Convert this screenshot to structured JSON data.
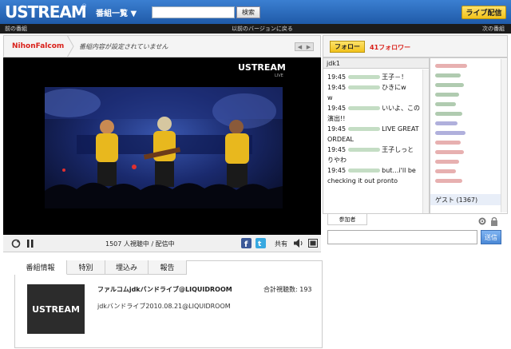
{
  "header": {
    "logo": "USTREAM",
    "logo_mark": "®",
    "menu_label": "番組一覧 ▼",
    "search_placeholder": "",
    "search_button": "検索",
    "live_button": "ライブ配信"
  },
  "subbar": {
    "prev": "前の番組",
    "old_version": "以前のバージョンに戻る",
    "next": "次の番組"
  },
  "channel": {
    "name": "NihonFalcom",
    "description": "番組内容が設定されていません",
    "nav": [
      "◀",
      "▶"
    ]
  },
  "follow": {
    "button": "フォロー",
    "count": "41フォロワー"
  },
  "video": {
    "watermark": "USTREAM",
    "watermark_sub": "LIVE"
  },
  "player": {
    "viewers": "1507 人視聴中 / 配信中",
    "share": "共有",
    "icons": [
      "refresh-icon",
      "pause-icon",
      "facebook-icon",
      "twitter-icon",
      "volume-icon",
      "fullscreen-icon"
    ]
  },
  "chat": {
    "room": "jdk1",
    "messages": [
      {
        "time": "19:45",
        "text": "王子－！"
      },
      {
        "time": "19:45",
        "text": "ひきにw"
      },
      {
        "time": "",
        "text": "w"
      },
      {
        "time": "19:45",
        "text": "いいよ、この"
      },
      {
        "time": "",
        "text": "演出!!"
      },
      {
        "time": "19:45",
        "text": "LIVE GREAT"
      },
      {
        "time": "",
        "text": "ORDEAL"
      },
      {
        "time": "19:45",
        "text": "王子しっと"
      },
      {
        "time": "",
        "text": "りやわ"
      },
      {
        "time": "19:45",
        "text": "but…i'll be"
      },
      {
        "time": "",
        "text": "checking it out pronto"
      }
    ],
    "guest_label": "ゲスト (1367)",
    "participants_tab": "参加者",
    "send_button": "送信"
  },
  "info": {
    "tabs": [
      "番組情報",
      "特別",
      "埋込み",
      "報告"
    ],
    "thumb_logo": "USTREAM",
    "program_title": "ファルコムjdkバンドライブ@LIQUIDROOM",
    "total_views": "合計視聴数: 193",
    "program_sub": "jdkバンドライブ2010.08.21@LIQUIDROOM"
  },
  "colors": {
    "header_blue": "#2a6bc0",
    "accent_yellow": "#f2c21a",
    "channel_red": "#d9201a"
  }
}
